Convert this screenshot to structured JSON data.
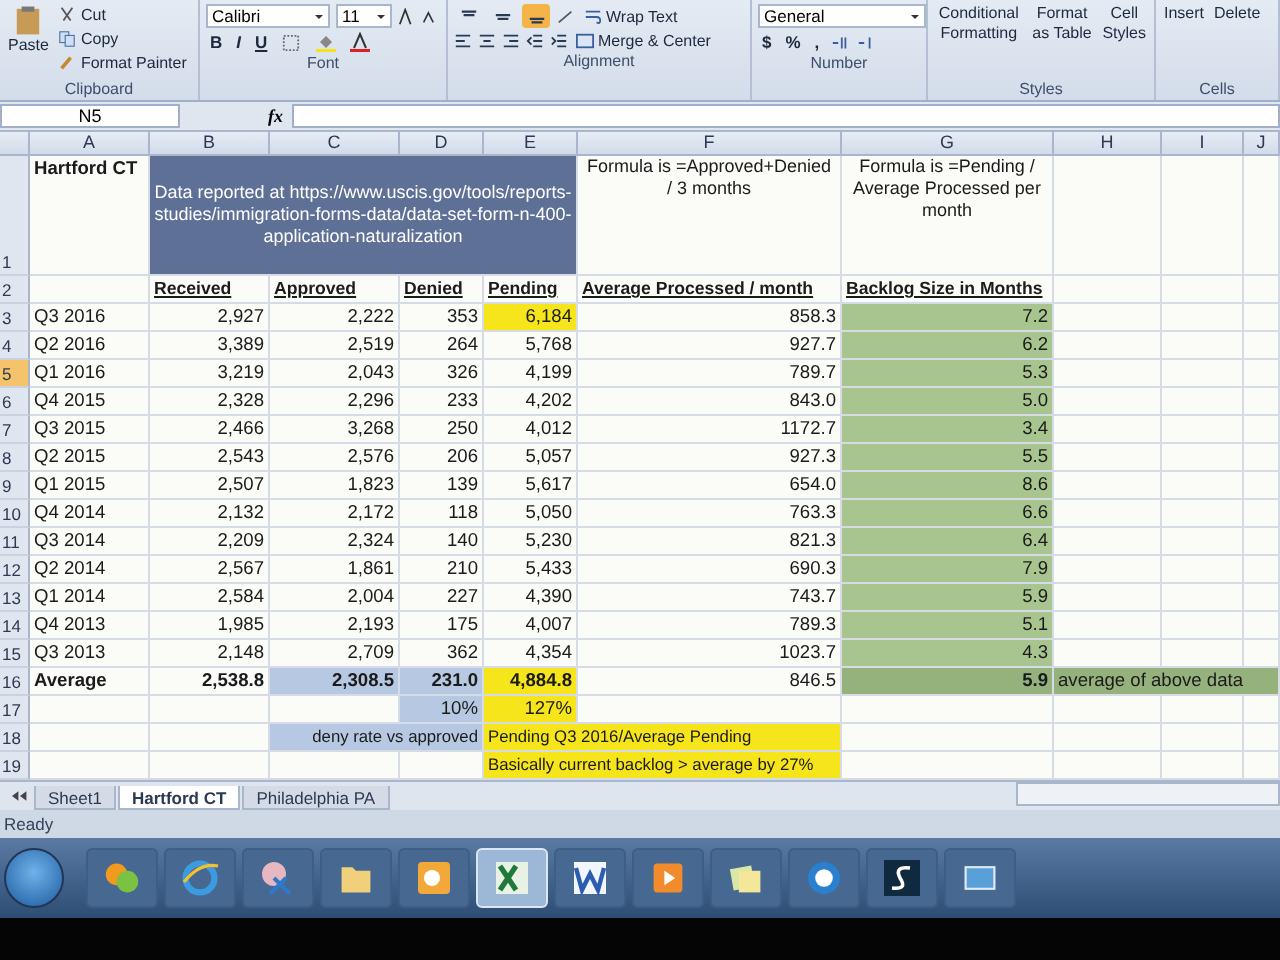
{
  "ribbon": {
    "clipboard": {
      "label": "Clipboard",
      "paste": "Paste",
      "cut": "Cut",
      "copy": "Copy",
      "format_painter": "Format Painter"
    },
    "font": {
      "label": "Font",
      "font_name": "Calibri",
      "font_size": "11",
      "bold": "B",
      "italic": "I",
      "underline": "U"
    },
    "alignment": {
      "label": "Alignment",
      "vertical_buttons": [
        {
          "selected": false
        },
        {
          "selected": false
        },
        {
          "selected": true
        }
      ],
      "wrap_text": "Wrap Text",
      "merge_center": "Merge & Center"
    },
    "number": {
      "label": "Number",
      "format": "General",
      "currency": "$",
      "percent": "%",
      "comma": ","
    },
    "styles": {
      "label": "Styles",
      "conditional": "Conditional Formatting",
      "format_table": "Format as Table",
      "cell_styles": "Cell Styles"
    },
    "cells": {
      "label": "Cells",
      "insert": "Insert",
      "delete": "Delete"
    }
  },
  "formula_bar": {
    "name_box": "N5",
    "function_label": "fx"
  },
  "sheet": {
    "columns": [
      "A",
      "B",
      "C",
      "D",
      "E",
      "F",
      "G",
      "H",
      "I",
      "J"
    ],
    "rows": [
      {
        "number": "1",
        "selected": false,
        "cells": {
          "A": {
            "text": "Hartford CT",
            "kind": "bold-label"
          },
          "B": {
            "text": "Data reported at https://www.uscis.gov/tools/reports-studies/immigration-forms-data/data-set-form-n-400-application-naturalization",
            "kind": "banner",
            "color": "#5f7096"
          },
          "C": {
            "merged": true
          },
          "D": {
            "merged": true
          },
          "E": {
            "merged": true
          },
          "F": {
            "text": "Formula is =Approved+Denied / 3 months",
            "kind": "note"
          },
          "G": {
            "text": "Formula is =Pending / Average Processed per month",
            "kind": "note"
          }
        }
      },
      {
        "number": "2",
        "selected": false,
        "cells": {
          "B": {
            "text": "Received",
            "kind": "header"
          },
          "C": {
            "text": "Approved",
            "kind": "header"
          },
          "D": {
            "text": "Denied",
            "kind": "header"
          },
          "E": {
            "text": "Pending",
            "kind": "header"
          },
          "F": {
            "text": "Average Processed / month",
            "kind": "header"
          },
          "G": {
            "text": "Backlog Size in Months",
            "kind": "header"
          }
        }
      },
      {
        "number": "3",
        "selected": false,
        "cells": {
          "A": {
            "text": "Q3 2016",
            "kind": "label"
          },
          "B": {
            "text": "2,927",
            "kind": "number"
          },
          "C": {
            "text": "2,222",
            "kind": "number"
          },
          "D": {
            "text": "353",
            "kind": "number"
          },
          "E": {
            "text": "6,184",
            "kind": "number",
            "color": "#f6e51a"
          },
          "F": {
            "text": "858.3",
            "kind": "number"
          },
          "G": {
            "text": "7.2",
            "kind": "number",
            "color": "#a9c58f"
          }
        }
      },
      {
        "number": "4",
        "selected": false,
        "cells": {
          "A": {
            "text": "Q2 2016",
            "kind": "label"
          },
          "B": {
            "text": "3,389",
            "kind": "number"
          },
          "C": {
            "text": "2,519",
            "kind": "number"
          },
          "D": {
            "text": "264",
            "kind": "number"
          },
          "E": {
            "text": "5,768",
            "kind": "number"
          },
          "F": {
            "text": "927.7",
            "kind": "number"
          },
          "G": {
            "text": "6.2",
            "kind": "number",
            "color": "#a9c58f"
          }
        }
      },
      {
        "number": "5",
        "selected": true,
        "cells": {
          "A": {
            "text": "Q1 2016",
            "kind": "label"
          },
          "B": {
            "text": "3,219",
            "kind": "number"
          },
          "C": {
            "text": "2,043",
            "kind": "number"
          },
          "D": {
            "text": "326",
            "kind": "number"
          },
          "E": {
            "text": "4,199",
            "kind": "number"
          },
          "F": {
            "text": "789.7",
            "kind": "number"
          },
          "G": {
            "text": "5.3",
            "kind": "number",
            "color": "#a9c58f"
          }
        }
      },
      {
        "number": "6",
        "selected": false,
        "cells": {
          "A": {
            "text": "Q4 2015",
            "kind": "label"
          },
          "B": {
            "text": "2,328",
            "kind": "number"
          },
          "C": {
            "text": "2,296",
            "kind": "number"
          },
          "D": {
            "text": "233",
            "kind": "number"
          },
          "E": {
            "text": "4,202",
            "kind": "number"
          },
          "F": {
            "text": "843.0",
            "kind": "number"
          },
          "G": {
            "text": "5.0",
            "kind": "number",
            "color": "#a9c58f"
          }
        }
      },
      {
        "number": "7",
        "selected": false,
        "cells": {
          "A": {
            "text": "Q3 2015",
            "kind": "label"
          },
          "B": {
            "text": "2,466",
            "kind": "number"
          },
          "C": {
            "text": "3,268",
            "kind": "number"
          },
          "D": {
            "text": "250",
            "kind": "number"
          },
          "E": {
            "text": "4,012",
            "kind": "number"
          },
          "F": {
            "text": "1172.7",
            "kind": "number"
          },
          "G": {
            "text": "3.4",
            "kind": "number",
            "color": "#a9c58f"
          }
        }
      },
      {
        "number": "8",
        "selected": false,
        "cells": {
          "A": {
            "text": "Q2 2015",
            "kind": "label"
          },
          "B": {
            "text": "2,543",
            "kind": "number"
          },
          "C": {
            "text": "2,576",
            "kind": "number"
          },
          "D": {
            "text": "206",
            "kind": "number"
          },
          "E": {
            "text": "5,057",
            "kind": "number"
          },
          "F": {
            "text": "927.3",
            "kind": "number"
          },
          "G": {
            "text": "5.5",
            "kind": "number",
            "color": "#a9c58f"
          }
        }
      },
      {
        "number": "9",
        "selected": false,
        "cells": {
          "A": {
            "text": "Q1 2015",
            "kind": "label"
          },
          "B": {
            "text": "2,507",
            "kind": "number"
          },
          "C": {
            "text": "1,823",
            "kind": "number"
          },
          "D": {
            "text": "139",
            "kind": "number"
          },
          "E": {
            "text": "5,617",
            "kind": "number"
          },
          "F": {
            "text": "654.0",
            "kind": "number"
          },
          "G": {
            "text": "8.6",
            "kind": "number",
            "color": "#a9c58f"
          }
        }
      },
      {
        "number": "10",
        "selected": false,
        "cells": {
          "A": {
            "text": "Q4 2014",
            "kind": "label"
          },
          "B": {
            "text": "2,132",
            "kind": "number"
          },
          "C": {
            "text": "2,172",
            "kind": "number"
          },
          "D": {
            "text": "118",
            "kind": "number"
          },
          "E": {
            "text": "5,050",
            "kind": "number"
          },
          "F": {
            "text": "763.3",
            "kind": "number"
          },
          "G": {
            "text": "6.6",
            "kind": "number",
            "color": "#a9c58f"
          }
        }
      },
      {
        "number": "11",
        "selected": false,
        "cells": {
          "A": {
            "text": "Q3 2014",
            "kind": "label"
          },
          "B": {
            "text": "2,209",
            "kind": "number"
          },
          "C": {
            "text": "2,324",
            "kind": "number"
          },
          "D": {
            "text": "140",
            "kind": "number"
          },
          "E": {
            "text": "5,230",
            "kind": "number"
          },
          "F": {
            "text": "821.3",
            "kind": "number"
          },
          "G": {
            "text": "6.4",
            "kind": "number",
            "color": "#a9c58f"
          }
        }
      },
      {
        "number": "12",
        "selected": false,
        "cells": {
          "A": {
            "text": "Q2 2014",
            "kind": "label"
          },
          "B": {
            "text": "2,567",
            "kind": "number"
          },
          "C": {
            "text": "1,861",
            "kind": "number"
          },
          "D": {
            "text": "210",
            "kind": "number"
          },
          "E": {
            "text": "5,433",
            "kind": "number"
          },
          "F": {
            "text": "690.3",
            "kind": "number"
          },
          "G": {
            "text": "7.9",
            "kind": "number",
            "color": "#a9c58f"
          }
        }
      },
      {
        "number": "13",
        "selected": false,
        "cells": {
          "A": {
            "text": "Q1 2014",
            "kind": "label"
          },
          "B": {
            "text": "2,584",
            "kind": "number"
          },
          "C": {
            "text": "2,004",
            "kind": "number"
          },
          "D": {
            "text": "227",
            "kind": "number"
          },
          "E": {
            "text": "4,390",
            "kind": "number"
          },
          "F": {
            "text": "743.7",
            "kind": "number"
          },
          "G": {
            "text": "5.9",
            "kind": "number",
            "color": "#a9c58f"
          }
        }
      },
      {
        "number": "14",
        "selected": false,
        "cells": {
          "A": {
            "text": "Q4 2013",
            "kind": "label"
          },
          "B": {
            "text": "1,985",
            "kind": "number"
          },
          "C": {
            "text": "2,193",
            "kind": "number"
          },
          "D": {
            "text": "175",
            "kind": "number"
          },
          "E": {
            "text": "4,007",
            "kind": "number"
          },
          "F": {
            "text": "789.3",
            "kind": "number"
          },
          "G": {
            "text": "5.1",
            "kind": "number",
            "color": "#a9c58f"
          }
        }
      },
      {
        "number": "15",
        "selected": false,
        "cells": {
          "A": {
            "text": "Q3 2013",
            "kind": "label"
          },
          "B": {
            "text": "2,148",
            "kind": "number"
          },
          "C": {
            "text": "2,709",
            "kind": "number"
          },
          "D": {
            "text": "362",
            "kind": "number"
          },
          "E": {
            "text": "4,354",
            "kind": "number"
          },
          "F": {
            "text": "1023.7",
            "kind": "number"
          },
          "G": {
            "text": "4.3",
            "kind": "number",
            "color": "#a9c58f"
          }
        }
      },
      {
        "number": "16",
        "selected": false,
        "cells": {
          "A": {
            "text": "Average",
            "kind": "bold-label"
          },
          "B": {
            "text": "2,538.8",
            "kind": "bold-number"
          },
          "C": {
            "text": "2,308.5",
            "kind": "bold-number",
            "color": "#b7c9e2"
          },
          "D": {
            "text": "231.0",
            "kind": "bold-number",
            "color": "#b7c9e2"
          },
          "E": {
            "text": "4,884.8",
            "kind": "bold-number",
            "color": "#f6e51a"
          },
          "F": {
            "text": "846.5",
            "kind": "number"
          },
          "G": {
            "text": "5.9",
            "kind": "bold-number",
            "color": "#95b27d"
          },
          "H": {
            "text": "average of above data",
            "kind": "label",
            "color": "#95b27d"
          },
          "I": {
            "merged": true
          },
          "J": {
            "merged": true
          }
        }
      },
      {
        "number": "17",
        "selected": false,
        "cells": {
          "D": {
            "text": "10%",
            "kind": "number",
            "color": "#b7c9e2"
          },
          "E": {
            "text": "127%",
            "kind": "number",
            "color": "#f6e51a"
          }
        }
      },
      {
        "number": "18",
        "selected": false,
        "cells": {
          "C": {
            "text": "deny rate vs approved",
            "kind": "right-caption",
            "color": "#b7c9e2"
          },
          "D": {
            "merged": true
          },
          "E": {
            "text": "Pending Q3 2016/Average Pending",
            "kind": "caption",
            "color": "#f6e51a"
          },
          "F": {
            "merged": true
          }
        }
      },
      {
        "number": "19",
        "selected": false,
        "cells": {
          "E": {
            "text": "Basically current backlog > average by 27%",
            "kind": "caption",
            "color": "#f6e51a"
          },
          "F": {
            "merged": true
          }
        }
      }
    ]
  },
  "sheet_tabs": [
    {
      "label": "Sheet1",
      "selected": false
    },
    {
      "label": "Hartford CT",
      "selected": true
    },
    {
      "label": "Philadelphia PA",
      "selected": false
    }
  ],
  "status_bar": {
    "text": "Ready"
  },
  "taskbar": {
    "apps": [
      {
        "kind": "chat",
        "selected": false
      },
      {
        "kind": "browser",
        "selected": false
      },
      {
        "kind": "snip",
        "selected": false
      },
      {
        "kind": "folder",
        "selected": false
      },
      {
        "kind": "mail",
        "selected": false
      },
      {
        "kind": "spreadsheet",
        "selected": true
      },
      {
        "kind": "document",
        "selected": false
      },
      {
        "kind": "media",
        "selected": false
      },
      {
        "kind": "notes",
        "selected": false
      },
      {
        "kind": "remote",
        "selected": false
      },
      {
        "kind": "terminal",
        "selected": false
      },
      {
        "kind": "picture",
        "selected": false
      }
    ]
  }
}
